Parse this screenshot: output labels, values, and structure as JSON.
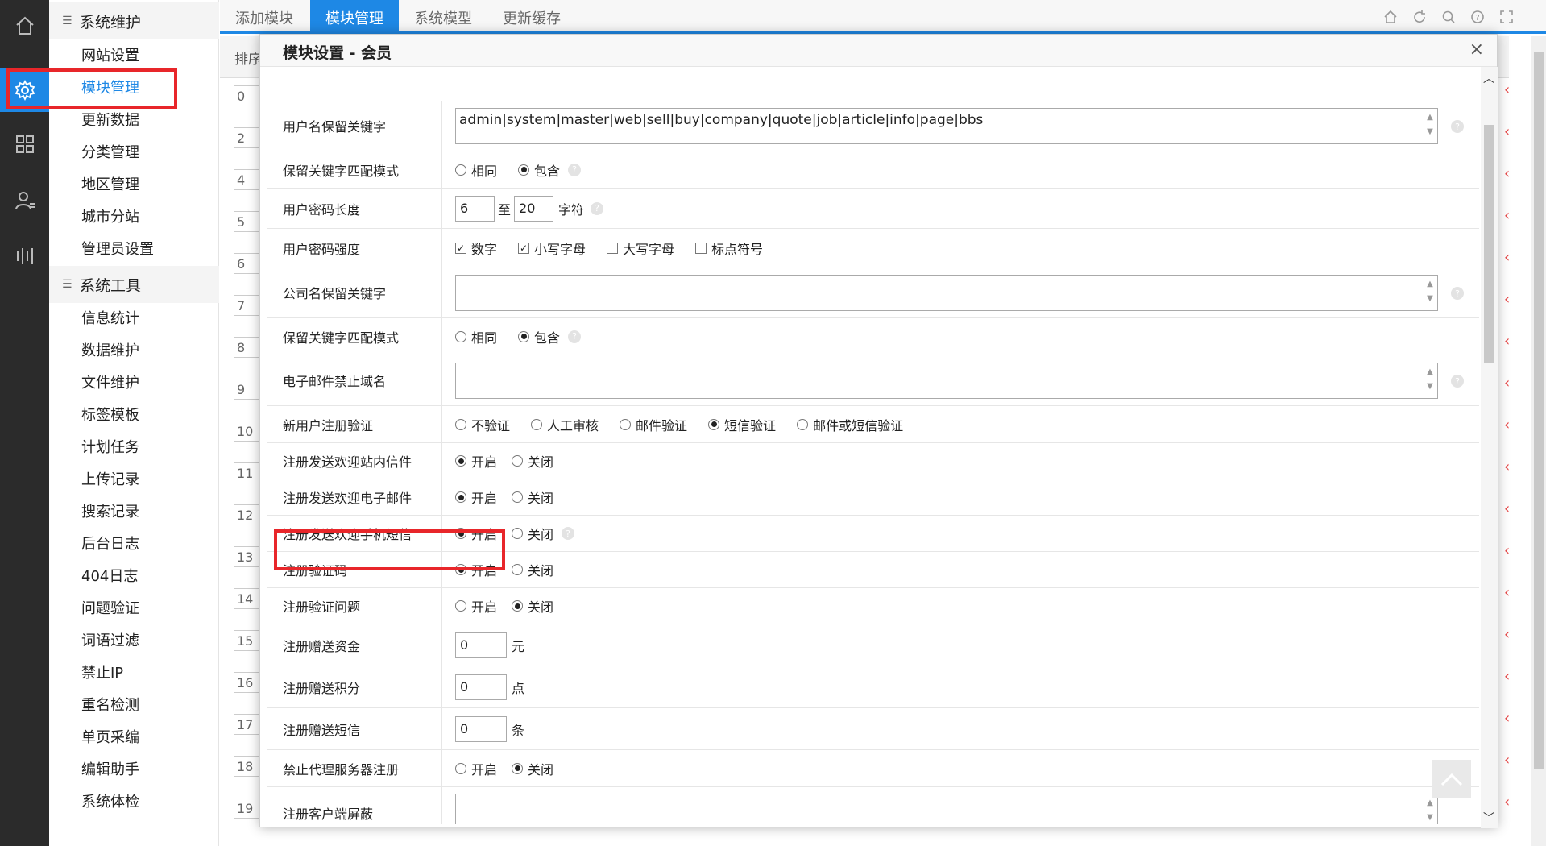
{
  "sidebar": {
    "groups": [
      {
        "title": "系统维护",
        "items": [
          "网站设置",
          "模块管理",
          "更新数据",
          "分类管理",
          "地区管理",
          "城市分站",
          "管理员设置"
        ]
      },
      {
        "title": "系统工具",
        "items": [
          "信息统计",
          "数据维护",
          "文件维护",
          "标签模板",
          "计划任务",
          "上传记录",
          "搜索记录",
          "后台日志",
          "404日志",
          "问题验证",
          "词语过滤",
          "禁止IP",
          "重名检测",
          "单页采编",
          "编辑助手",
          "系统体检"
        ]
      }
    ],
    "active_item": "模块管理"
  },
  "tabs": [
    "添加模块",
    "模块管理",
    "系统模型",
    "更新缓存"
  ],
  "active_tab": "模块管理",
  "bg_table": {
    "header": "排序",
    "row_numbers": [
      "0",
      "2",
      "4",
      "5",
      "6",
      "7",
      "8",
      "9",
      "10",
      "11",
      "12",
      "13",
      "14",
      "15",
      "16",
      "17",
      "18",
      "19"
    ]
  },
  "modal": {
    "title": "模块设置 - 会员",
    "close": "×",
    "rows": {
      "r1": {
        "label": "用户名保留关键字",
        "value": "admin|system|master|web|sell|buy|company|quote|job|article|info|page|bbs"
      },
      "r2": {
        "label": "保留关键字匹配模式",
        "opt1": "相同",
        "opt2": "包含"
      },
      "r3": {
        "label": "用户密码长度",
        "min": "6",
        "sep": "至",
        "max": "20",
        "unit": "字符"
      },
      "r4": {
        "label": "用户密码强度",
        "opt1": "数字",
        "opt2": "小写字母",
        "opt3": "大写字母",
        "opt4": "标点符号"
      },
      "r5": {
        "label": "公司名保留关键字",
        "value": ""
      },
      "r6": {
        "label": "保留关键字匹配模式",
        "opt1": "相同",
        "opt2": "包含"
      },
      "r7": {
        "label": "电子邮件禁止域名",
        "value": ""
      },
      "r8": {
        "label": "新用户注册验证",
        "opt1": "不验证",
        "opt2": "人工审核",
        "opt3": "邮件验证",
        "opt4": "短信验证",
        "opt5": "邮件或短信验证"
      },
      "r9": {
        "label": "注册发送欢迎站内信件",
        "on": "开启",
        "off": "关闭"
      },
      "r10": {
        "label": "注册发送欢迎电子邮件",
        "on": "开启",
        "off": "关闭"
      },
      "r11": {
        "label": "注册发送欢迎手机短信",
        "on": "开启",
        "off": "关闭"
      },
      "r12": {
        "label": "注册验证码",
        "on": "开启",
        "off": "关闭"
      },
      "r13": {
        "label": "注册验证问题",
        "on": "开启",
        "off": "关闭"
      },
      "r14": {
        "label": "注册赠送资金",
        "value": "0",
        "unit": "元"
      },
      "r15": {
        "label": "注册赠送积分",
        "value": "0",
        "unit": "点"
      },
      "r16": {
        "label": "注册赠送短信",
        "value": "0",
        "unit": "条"
      },
      "r17": {
        "label": "禁止代理服务器注册",
        "on": "开启",
        "off": "关闭"
      },
      "r18": {
        "label": "注册客户端屏蔽",
        "value": ""
      }
    }
  },
  "colors": {
    "accent": "#1e88e5",
    "highlight": "#e8262a",
    "rail": "#2b2b2b"
  },
  "icons": [
    "home-icon",
    "gear-icon",
    "grid-icon",
    "user-icon",
    "bars-icon",
    "refresh-icon",
    "search-icon",
    "help-icon",
    "fullscreen-icon"
  ]
}
